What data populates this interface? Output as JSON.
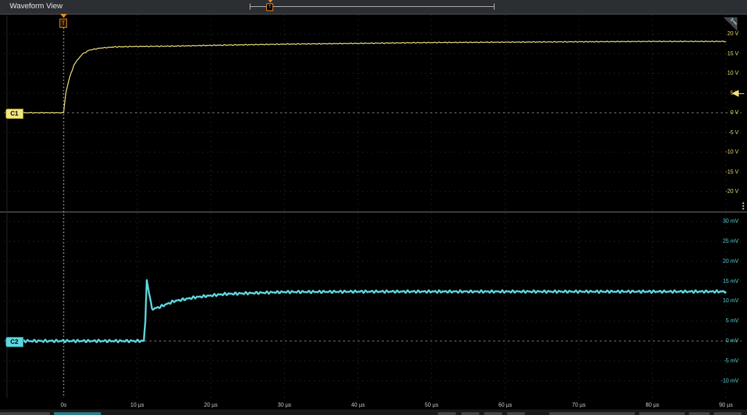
{
  "window": {
    "title": "Waveform View"
  },
  "channels": [
    {
      "name": "C1",
      "color": "#f2e681",
      "unit": "V"
    },
    {
      "name": "C2",
      "color": "#5fd6de",
      "unit": "mV"
    }
  ],
  "trigger": {
    "marker_label": "T"
  },
  "icons": {
    "corner": "wrench-icon",
    "side": "drag-handle-icon"
  },
  "chart_data": [
    {
      "type": "line",
      "title": "",
      "channel": "C1",
      "ylim": [
        -25,
        22
      ],
      "xlim": [
        -7.8,
        90
      ],
      "ytick_labels": [
        "20 V",
        "15 V",
        "10 V",
        "5 V",
        "0 V",
        "-5 V",
        "-10 V",
        "-15 V",
        "-20 V"
      ],
      "ytick_values": [
        20,
        15,
        10,
        5,
        0,
        -5,
        -10,
        -15,
        -20
      ],
      "series": [
        {
          "name": "C1",
          "x": [
            -7.8,
            -4,
            0,
            0.3,
            0.8,
            1.5,
            2.5,
            3.5,
            5,
            7,
            10,
            15,
            20,
            30,
            40,
            50,
            60,
            70,
            80,
            90
          ],
          "y": [
            0,
            0,
            0,
            5,
            9,
            12.5,
            14.8,
            15.9,
            16.4,
            16.7,
            16.8,
            16.9,
            17.1,
            17.4,
            17.6,
            17.8,
            17.9,
            18,
            18.1,
            18.1
          ]
        }
      ]
    },
    {
      "type": "line",
      "title": "",
      "channel": "C2",
      "ylim": [
        -12.5,
        32
      ],
      "xlim": [
        -7.8,
        90
      ],
      "ytick_labels": [
        "30 mV",
        "25 mV",
        "20 mV",
        "15 mV",
        "10 mV",
        "5 mV",
        "0 mV",
        "-5 mV",
        "-10 mV"
      ],
      "ytick_values": [
        30,
        25,
        20,
        15,
        10,
        5,
        0,
        -5,
        -10
      ],
      "series": [
        {
          "name": "C2",
          "x": [
            -7.8,
            0,
            5,
            10.9,
            11.1,
            11.3,
            11.6,
            12,
            13,
            15,
            18,
            22,
            30,
            40,
            60,
            90
          ],
          "y": [
            0,
            0,
            0,
            0,
            5,
            15.5,
            12,
            8,
            8.5,
            10,
            11,
            11.8,
            12.3,
            12.4,
            12.4,
            12.4
          ]
        }
      ]
    }
  ],
  "xaxis": {
    "tick_labels": [
      "0s",
      "10 µs",
      "20 µs",
      "30 µs",
      "40 µs",
      "50 µs",
      "60 µs",
      "70 µs",
      "80 µs",
      "90 µs"
    ],
    "tick_values": [
      0,
      10,
      20,
      30,
      40,
      50,
      60,
      70,
      80,
      90
    ]
  }
}
